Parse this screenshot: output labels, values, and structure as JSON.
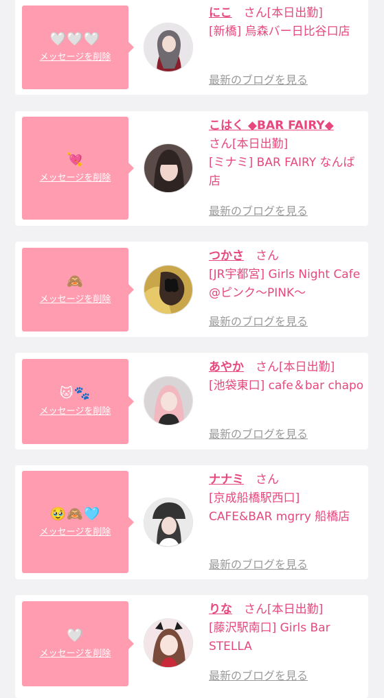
{
  "colors": {
    "page_bg": "#f2f2f4",
    "card_bg": "#ffffff",
    "bubble_bg": "#ff9cb0",
    "accent_text": "#e6487d",
    "link_gray": "#9a9a9a"
  },
  "delete_label": "メッセージを削除",
  "blog_label": "最新のブログを見る",
  "messages": [
    {
      "emoji": "🤍🤍🤍",
      "name": "にこ",
      "suffix": "　さん[本日出勤]",
      "shop": "[新橋] 烏森バー日比谷口店",
      "avatar_icon": "cast-photo-icon"
    },
    {
      "emoji": "💘",
      "name": "こはく ◆BAR FAIRY◆",
      "suffix": "さん[本日出勤]",
      "shop": "[ミナミ] BAR FAIRY なんば店",
      "avatar_icon": "cast-photo-icon"
    },
    {
      "emoji": "🙈",
      "name": "つかさ",
      "suffix": "　さん",
      "shop": "[JR宇都宮] Girls Night Cafe @ピンク〜PINK〜",
      "avatar_icon": "cast-photo-icon"
    },
    {
      "emoji": "🐱🐾",
      "name": "あやか",
      "suffix": "　さん[本日出勤]",
      "shop": "[池袋東口] cafe＆bar chapo",
      "avatar_icon": "cast-photo-icon"
    },
    {
      "emoji": "🥹🙈🩵",
      "name": "ナナミ",
      "suffix": "　さん",
      "shop": "[京成船橋駅西口] CAFE&BAR mgrry 船橋店",
      "avatar_icon": "cast-photo-icon"
    },
    {
      "emoji": "🤍",
      "name": "りな",
      "suffix": "　さん[本日出勤]",
      "shop": "[藤沢駅南口] Girls Bar STELLA",
      "avatar_icon": "cast-photo-icon"
    }
  ]
}
